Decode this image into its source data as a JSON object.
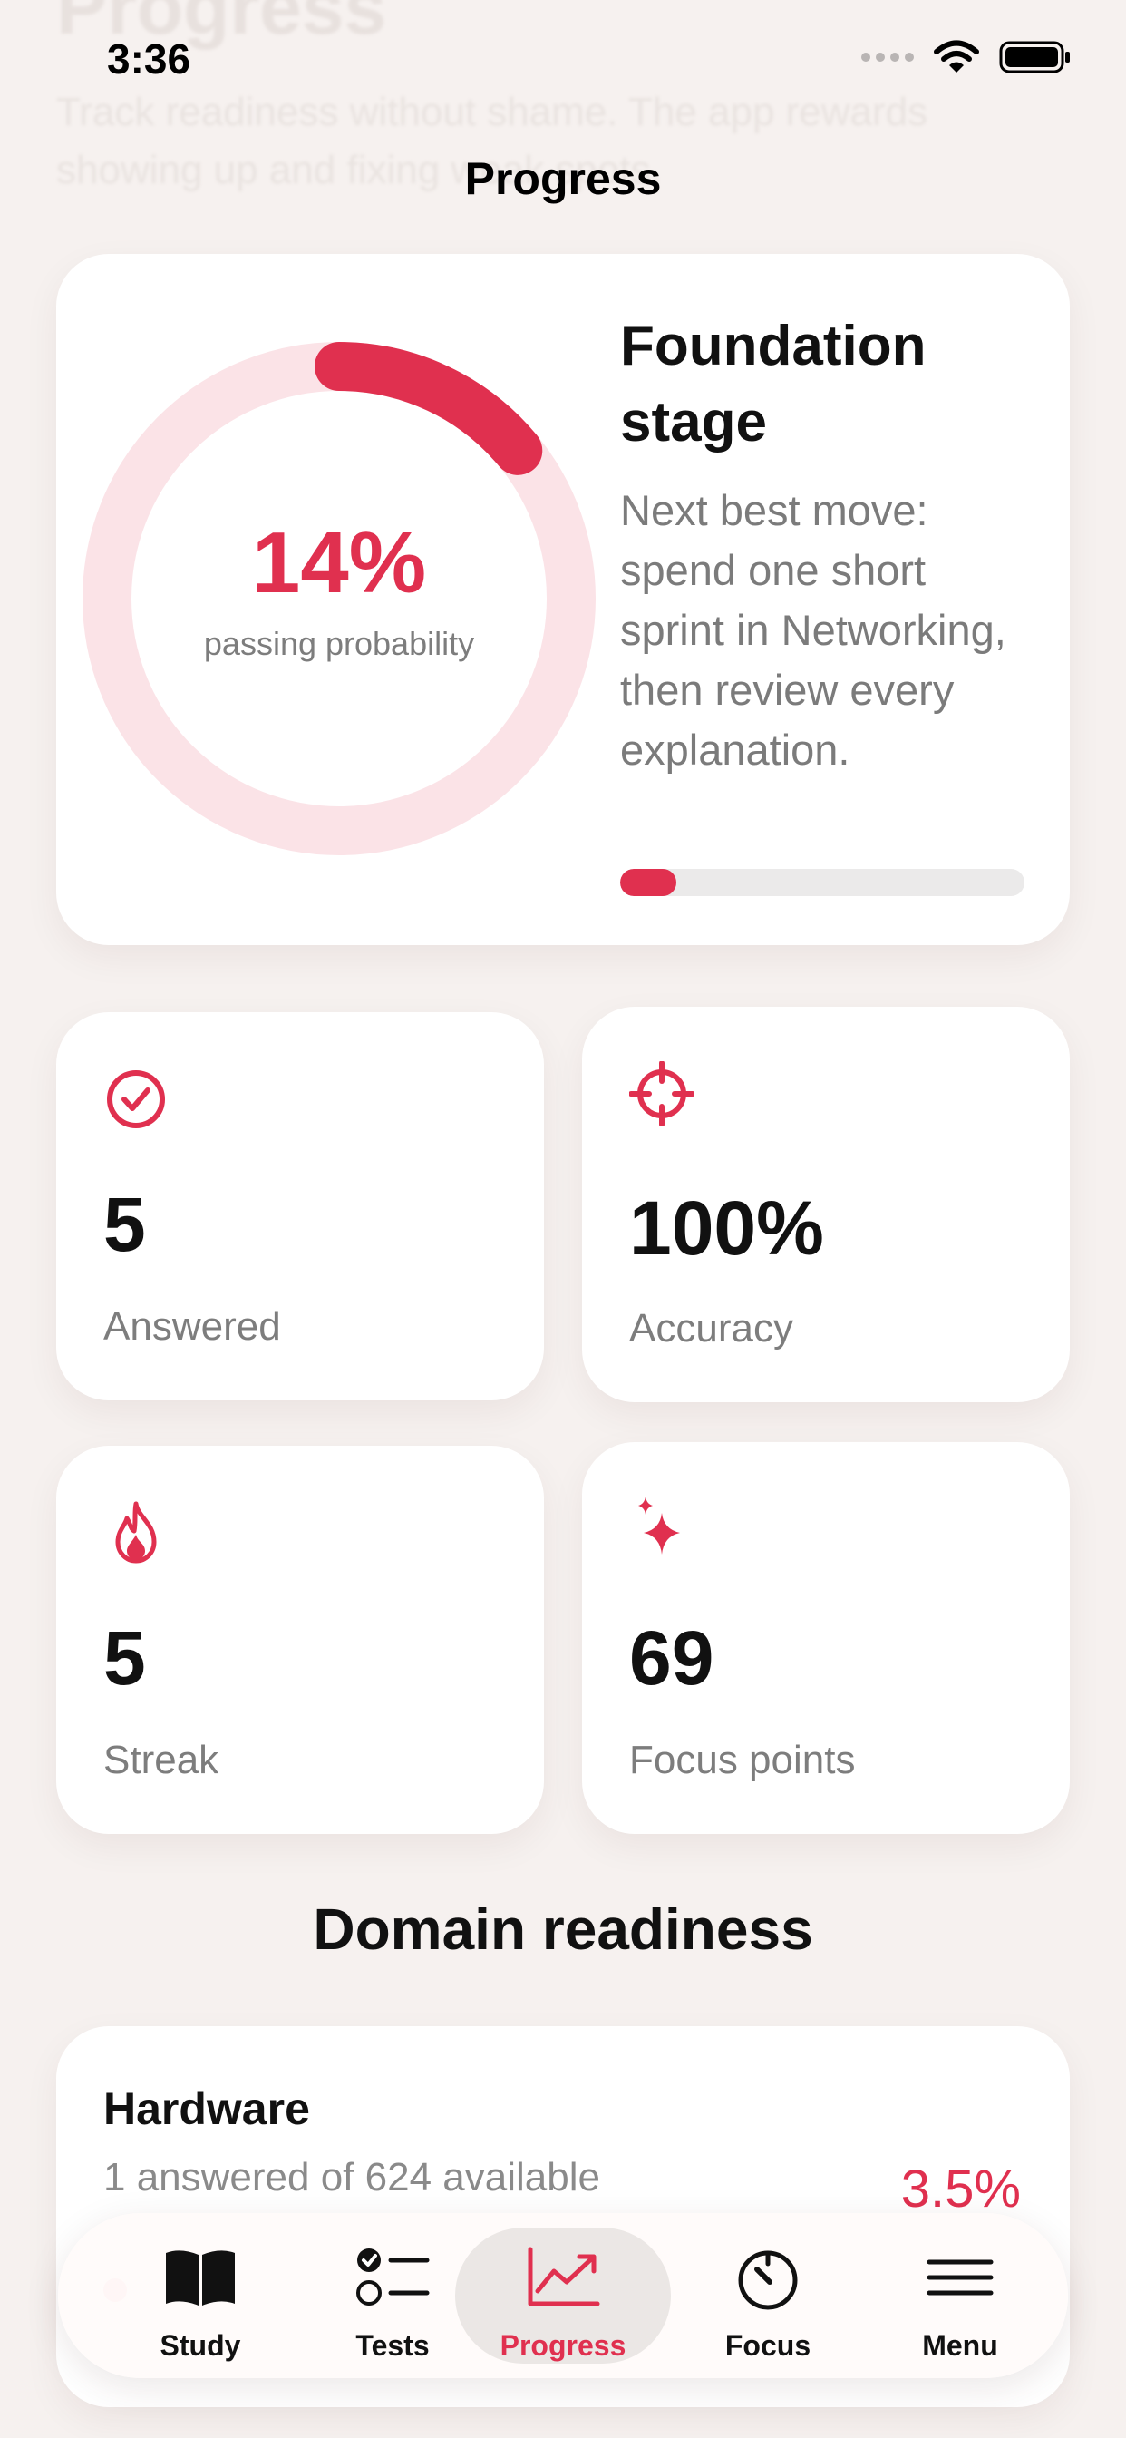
{
  "background_header": {
    "title": "Progress",
    "subtitle": "Track readiness without shame. The app rewards showing up and fixing weak spots."
  },
  "status_bar": {
    "time": "3:36"
  },
  "nav": {
    "title": "Progress"
  },
  "readiness": {
    "percent_text": "14%",
    "percent_value": 14,
    "percent_label": "passing probability",
    "stage_title": "Foundation stage",
    "next_move": "Next best move: spend one short sprint in Networking, then review every explanation.",
    "stage_progress": 0.14
  },
  "stats": [
    {
      "icon": "check-circle-icon",
      "value": "5",
      "label": "Answered"
    },
    {
      "icon": "target-icon",
      "value": "100%",
      "label": "Accuracy"
    },
    {
      "icon": "flame-icon",
      "value": "5",
      "label": "Streak"
    },
    {
      "icon": "sparkles-icon",
      "value": "69",
      "label": "Focus points"
    }
  ],
  "domain_section": {
    "title": "Domain readiness"
  },
  "domains": [
    {
      "name": "Hardware",
      "detail": "1 answered of 624 available",
      "percent": "3.5%"
    }
  ],
  "tabs": [
    {
      "label": "Study",
      "icon": "book-icon",
      "active": false
    },
    {
      "label": "Tests",
      "icon": "checklist-icon",
      "active": false
    },
    {
      "label": "Progress",
      "icon": "chart-line-icon",
      "active": true
    },
    {
      "label": "Focus",
      "icon": "timer-icon",
      "active": false
    },
    {
      "label": "Menu",
      "icon": "menu-icon",
      "active": false
    }
  ],
  "colors": {
    "accent": "#e0304f",
    "ring_track": "#fbe3e7",
    "background": "#f6f1ef"
  }
}
